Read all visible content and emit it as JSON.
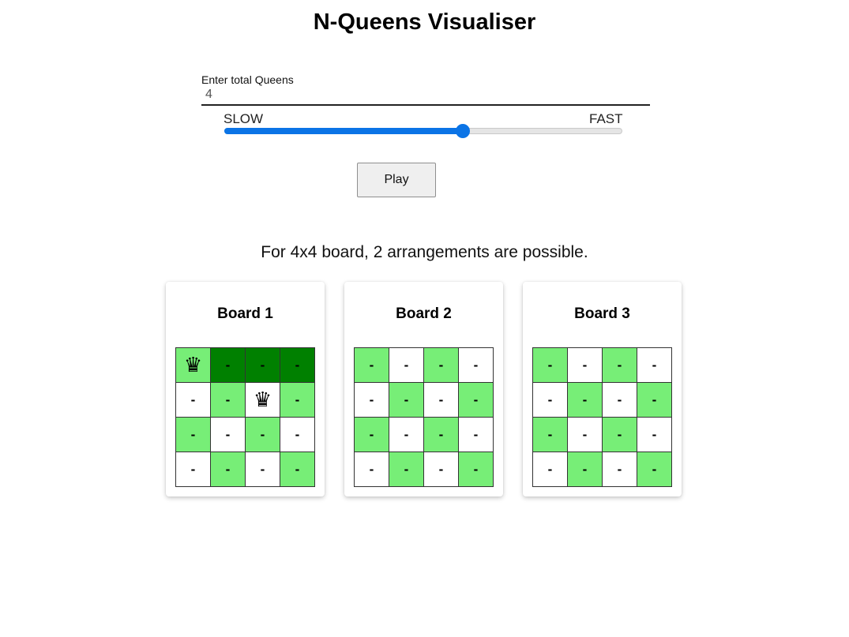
{
  "header": {
    "title": "N-Queens Visualiser"
  },
  "controls": {
    "queens_label": "Enter total Queens",
    "queens_value": "4",
    "speed_slow_label": "SLOW",
    "speed_fast_label": "FAST",
    "speed_fraction": 0.6,
    "play_label": "Play"
  },
  "result": {
    "message": "For 4x4 board, 2 arrangements are possible."
  },
  "colors": {
    "accent": "#0b74e6",
    "cell_green": "#77ee77",
    "cell_dark_green": "#008000",
    "cell_white": "#ffffff"
  },
  "boards": [
    {
      "title": "Board 1",
      "cells": [
        [
          "♛",
          "-",
          "-",
          "-"
        ],
        [
          "-",
          "-",
          "♛",
          "-"
        ],
        [
          "-",
          "-",
          "-",
          "-"
        ],
        [
          "-",
          "-",
          "-",
          "-"
        ]
      ],
      "shades": [
        [
          "green",
          "dark",
          "dark",
          "dark"
        ],
        [
          "light",
          "green",
          "light",
          "green"
        ],
        [
          "green",
          "light",
          "green",
          "light"
        ],
        [
          "light",
          "green",
          "light",
          "green"
        ]
      ]
    },
    {
      "title": "Board 2",
      "cells": [
        [
          "-",
          "-",
          "-",
          "-"
        ],
        [
          "-",
          "-",
          "-",
          "-"
        ],
        [
          "-",
          "-",
          "-",
          "-"
        ],
        [
          "-",
          "-",
          "-",
          "-"
        ]
      ],
      "shades": [
        [
          "green",
          "light",
          "green",
          "light"
        ],
        [
          "light",
          "green",
          "light",
          "green"
        ],
        [
          "green",
          "light",
          "green",
          "light"
        ],
        [
          "light",
          "green",
          "light",
          "green"
        ]
      ]
    },
    {
      "title": "Board 3",
      "cells": [
        [
          "-",
          "-",
          "-",
          "-"
        ],
        [
          "-",
          "-",
          "-",
          "-"
        ],
        [
          "-",
          "-",
          "-",
          "-"
        ],
        [
          "-",
          "-",
          "-",
          "-"
        ]
      ],
      "shades": [
        [
          "green",
          "light",
          "green",
          "light"
        ],
        [
          "light",
          "green",
          "light",
          "green"
        ],
        [
          "green",
          "light",
          "green",
          "light"
        ],
        [
          "light",
          "green",
          "light",
          "green"
        ]
      ]
    }
  ]
}
